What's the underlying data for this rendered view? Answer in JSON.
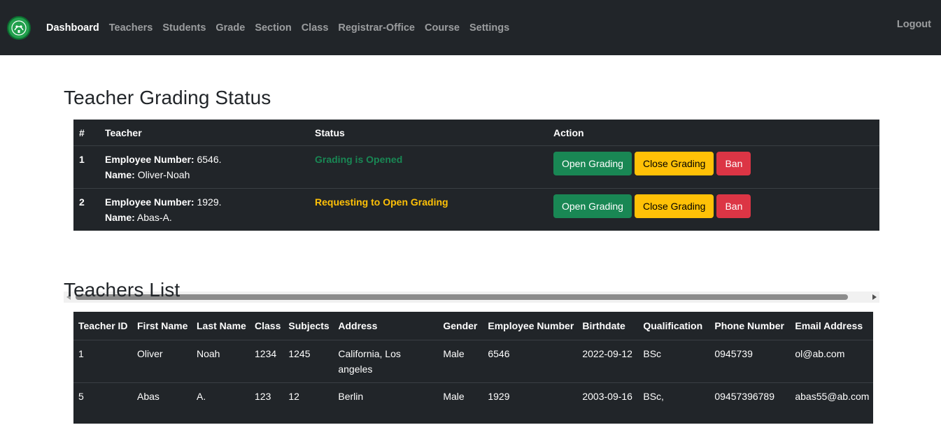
{
  "nav": {
    "items": [
      {
        "label": "Dashboard",
        "active": true
      },
      {
        "label": "Teachers",
        "active": false
      },
      {
        "label": "Students",
        "active": false
      },
      {
        "label": "Grade",
        "active": false
      },
      {
        "label": "Section",
        "active": false
      },
      {
        "label": "Class",
        "active": false
      },
      {
        "label": "Registrar-Office",
        "active": false
      },
      {
        "label": "Course",
        "active": false
      },
      {
        "label": "Settings",
        "active": false
      }
    ],
    "logout_label": "Logout"
  },
  "grading": {
    "title": "Teacher Grading Status",
    "headers": [
      "#",
      "Teacher",
      "Status",
      "Action"
    ],
    "emp_label": "Employee Number:",
    "name_label": "Name:",
    "buttons": {
      "open": "Open Grading",
      "close": "Close Grading",
      "ban": "Ban"
    },
    "rows": [
      {
        "num": "1",
        "employee_number": "6546.",
        "name": "Oliver-Noah",
        "status": "Grading is Opened"
      },
      {
        "num": "2",
        "employee_number": "1929.",
        "name": "Abas-A.",
        "status": "Requesting to Open Grading"
      }
    ]
  },
  "teachers": {
    "title": "Teachers List",
    "headers": [
      "Teacher ID",
      "First Name",
      "Last Name",
      "Class",
      "Subjects",
      "Address",
      "Gender",
      "Employee Number",
      "Birthdate",
      "Qualification",
      "Phone Number",
      "Email Address"
    ],
    "rows": [
      [
        "1",
        "Oliver",
        "Noah",
        "1234",
        "1245",
        "California, Los angeles",
        "Male",
        "6546",
        "2022-09-12",
        "BSc",
        "0945739",
        "ol@ab.com"
      ],
      [
        "5",
        "Abas",
        "A.",
        "123",
        "12",
        "Berlin",
        "Male",
        "1929",
        "2003-09-16",
        "BSc,",
        "09457396789",
        "abas55@ab.com"
      ]
    ]
  },
  "colors": {
    "navbar": "#212529",
    "success": "#198754",
    "warning": "#ffc107",
    "danger": "#dc3545"
  }
}
